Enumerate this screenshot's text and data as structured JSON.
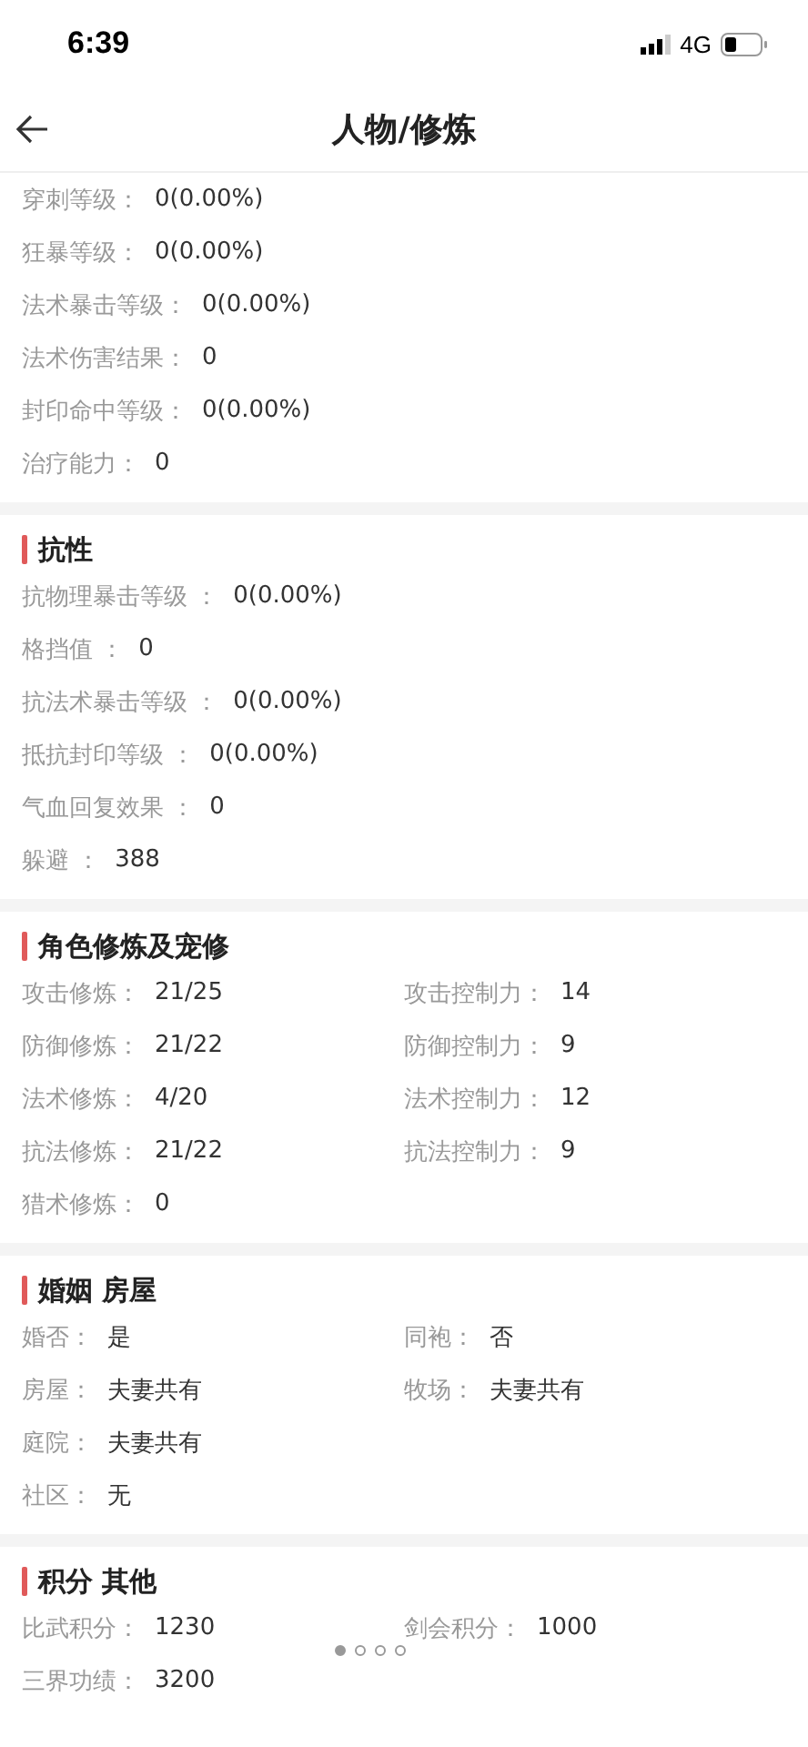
{
  "status_bar": {
    "time": "6:39",
    "network": "4G"
  },
  "nav": {
    "title": "人物/修炼"
  },
  "sections": [
    {
      "rows": [
        [
          {
            "label": "穿刺等级：",
            "value": "0(0.00%)"
          }
        ],
        [
          {
            "label": "狂暴等级：",
            "value": "0(0.00%)"
          }
        ],
        [
          {
            "label": "法术暴击等级：",
            "value": "0(0.00%)"
          }
        ],
        [
          {
            "label": "法术伤害结果：",
            "value": "0"
          }
        ],
        [
          {
            "label": "封印命中等级：",
            "value": "0(0.00%)"
          }
        ],
        [
          {
            "label": "治疗能力：",
            "value": "0"
          }
        ]
      ]
    },
    {
      "title": "抗性",
      "rows": [
        [
          {
            "label": "抗物理暴击等级 ：",
            "value": "0(0.00%)"
          }
        ],
        [
          {
            "label": "格挡值 ：",
            "value": "0"
          }
        ],
        [
          {
            "label": "抗法术暴击等级 ：",
            "value": "0(0.00%)"
          }
        ],
        [
          {
            "label": "抵抗封印等级 ：",
            "value": "0(0.00%)"
          }
        ],
        [
          {
            "label": "气血回复效果 ：",
            "value": "0"
          }
        ],
        [
          {
            "label": "躲避 ：",
            "value": "388"
          }
        ]
      ]
    },
    {
      "title": "角色修炼及宠修",
      "rows": [
        [
          {
            "label": "攻击修炼：",
            "value": "21/25"
          },
          {
            "label": "攻击控制力：",
            "value": "14"
          }
        ],
        [
          {
            "label": "防御修炼：",
            "value": "21/22"
          },
          {
            "label": "防御控制力：",
            "value": "9"
          }
        ],
        [
          {
            "label": "法术修炼：",
            "value": "4/20"
          },
          {
            "label": "法术控制力：",
            "value": "12"
          }
        ],
        [
          {
            "label": "抗法修炼：",
            "value": "21/22"
          },
          {
            "label": "抗法控制力：",
            "value": "9"
          }
        ],
        [
          {
            "label": "猎术修炼：",
            "value": "0"
          }
        ]
      ]
    },
    {
      "title": "婚姻 房屋",
      "rows": [
        [
          {
            "label": "婚否：",
            "value": "是"
          },
          {
            "label": "同袍：",
            "value": "否"
          }
        ],
        [
          {
            "label": "房屋：",
            "value": "夫妻共有"
          },
          {
            "label": "牧场：",
            "value": "夫妻共有"
          }
        ],
        [
          {
            "label": "庭院：",
            "value": "夫妻共有"
          }
        ],
        [
          {
            "label": "社区：",
            "value": "无"
          }
        ]
      ]
    },
    {
      "title": "积分 其他",
      "rows": [
        [
          {
            "label": "比武积分：",
            "value": "1230"
          },
          {
            "label": "剑会积分：",
            "value": "1000"
          }
        ],
        [
          {
            "label": "三界功绩：",
            "value": "3200"
          }
        ]
      ]
    }
  ],
  "page_dots": [
    {
      "selected": true
    },
    {
      "selected": false
    },
    {
      "selected": false
    },
    {
      "selected": false
    }
  ]
}
